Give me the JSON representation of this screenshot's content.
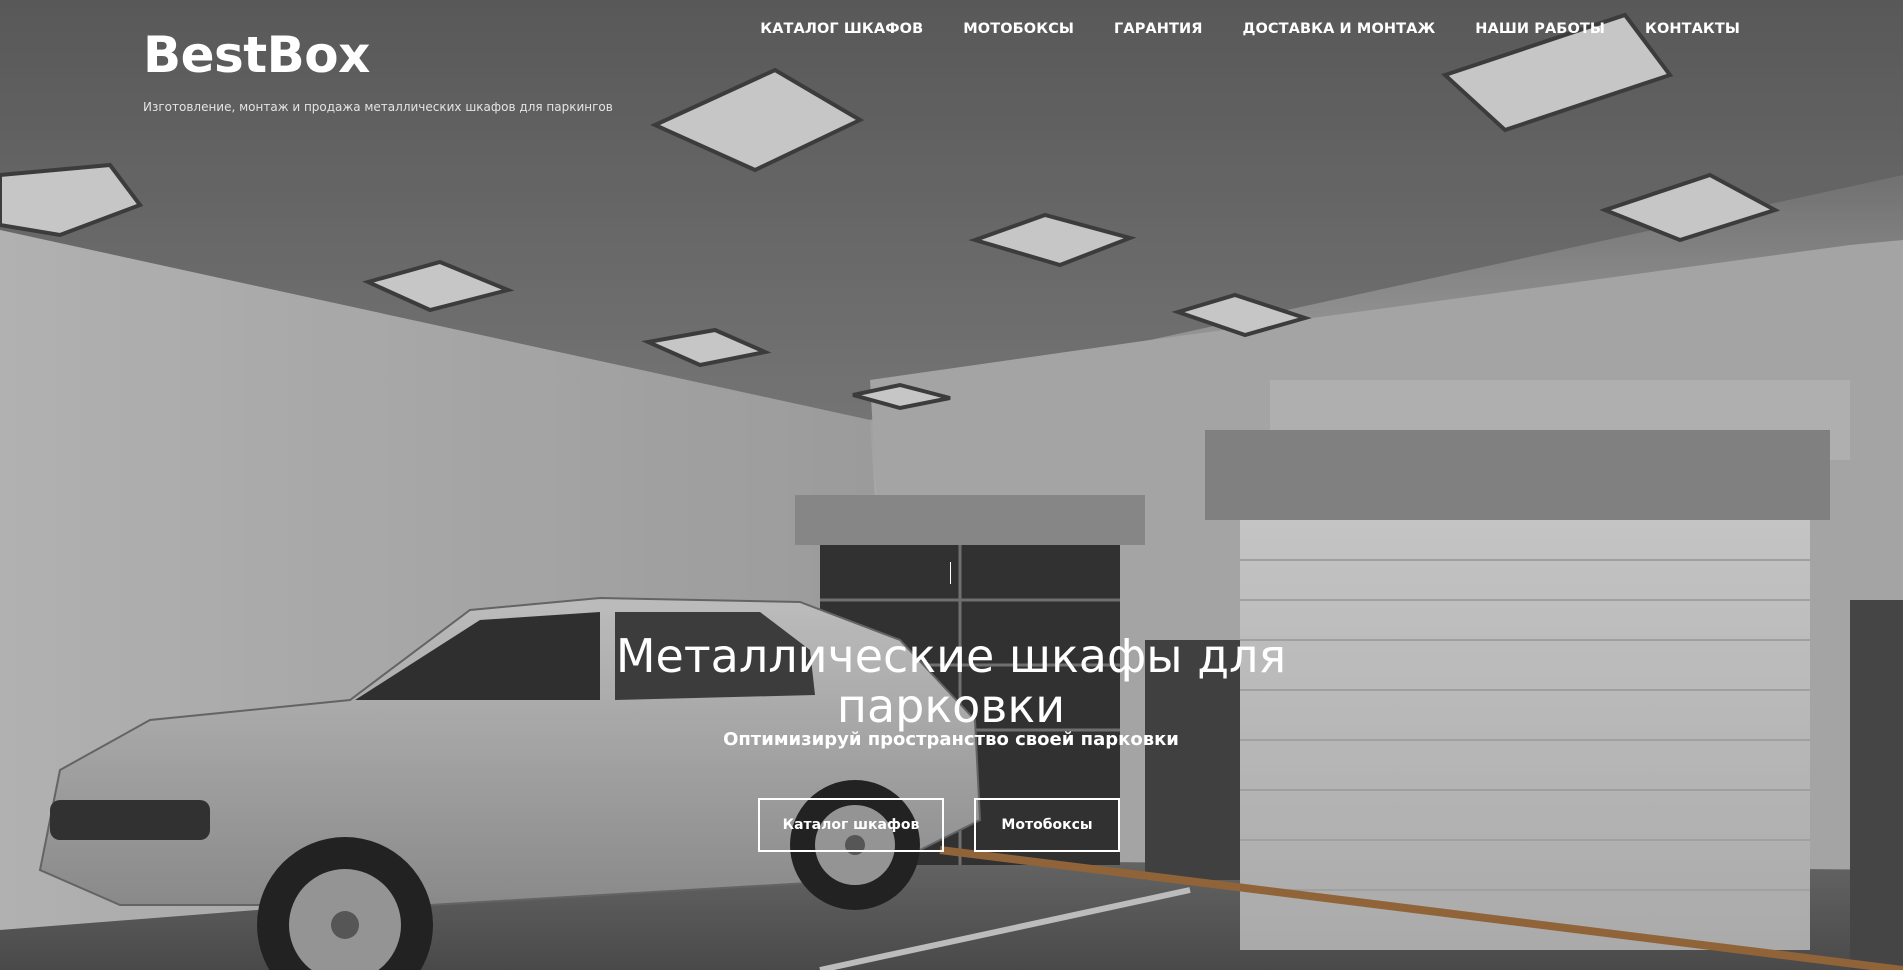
{
  "header": {
    "logo": "BestBox",
    "tagline": "Изготовление, монтаж и продажа металлических шкафов для паркингов"
  },
  "nav": {
    "items": [
      {
        "label": "КАТАЛОГ ШКАФОВ"
      },
      {
        "label": "МОТОБОКСЫ"
      },
      {
        "label": "ГАРАНТИЯ"
      },
      {
        "label": "ДОСТАВКА И МОНТАЖ"
      },
      {
        "label": "НАШИ РАБОТЫ"
      },
      {
        "label": "КОНТАКТЫ"
      }
    ]
  },
  "hero": {
    "title_line1": "Металлические шкафы для",
    "title_line2": "парковки",
    "subtitle": "Оптимизируй пространство своей парковки",
    "buttons": {
      "catalog": "Каталог шкафов",
      "moto": "Мотобоксы"
    }
  },
  "colors": {
    "text": "#ffffff",
    "background_tone": "#8a8a8a"
  }
}
